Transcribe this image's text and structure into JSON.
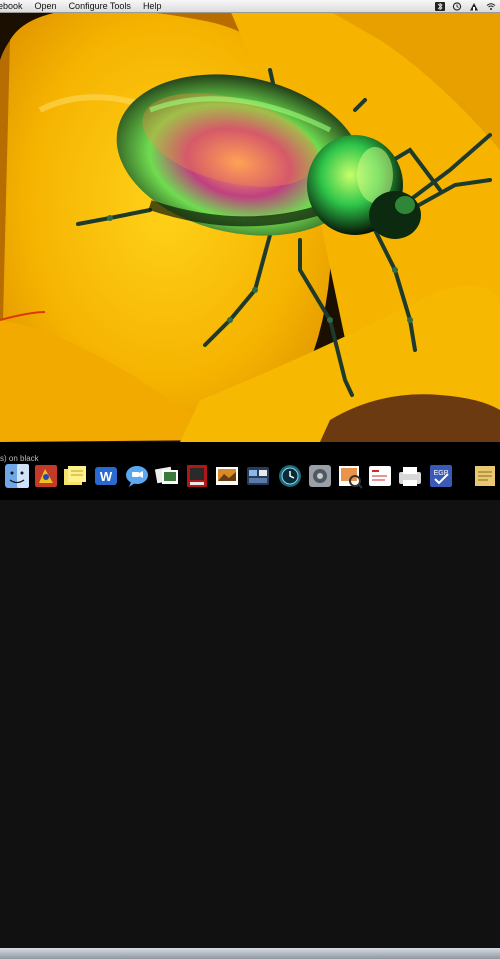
{
  "menubar": {
    "items": [
      "ebook",
      "Open",
      "Configure Tools",
      "Help"
    ],
    "extras": [
      "bluetooth-icon",
      "time-machine-icon",
      "user-icon",
      "wifi-icon"
    ]
  },
  "desktop": {
    "wallpaper": "iridescent green beetle on yellow flower petal",
    "colors": {
      "petal": "#f6b800",
      "petal_shadow": "#e39400",
      "beetle_shell": "#1f2a10",
      "beetle_sheen": "#5fd24a"
    }
  },
  "dock": {
    "caption": "s) on black",
    "icons": [
      "finder-icon",
      "address-book-icon",
      "stickies-icon",
      "word-icon",
      "ichat-icon",
      "photo-browser-icon",
      "photo-booth-icon",
      "iphoto-icon",
      "dashboard-icon",
      "time-machine-icon",
      "system-preferences-icon",
      "preview-icon",
      "smart-notebook-icon",
      "printer-icon",
      "egp-icon",
      "notes-icon"
    ]
  }
}
